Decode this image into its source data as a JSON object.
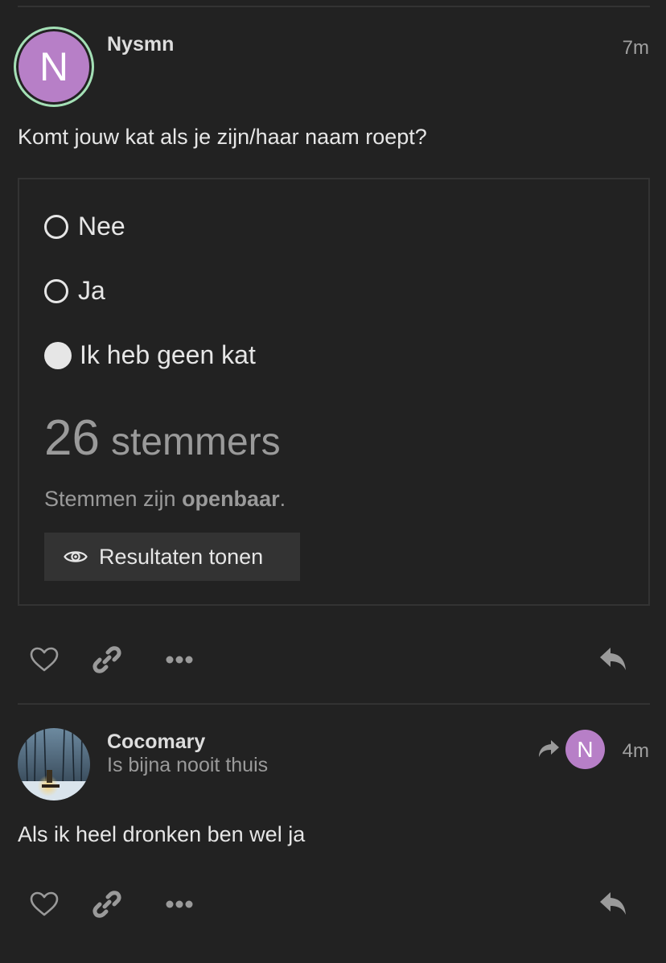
{
  "posts": [
    {
      "avatar_letter": "N",
      "username": "Nysmn",
      "time": "7m",
      "text": "Komt jouw kat als je zijn/haar naam roept?",
      "poll": {
        "options": [
          {
            "label": "Nee",
            "selected": false
          },
          {
            "label": "Ja",
            "selected": false
          },
          {
            "label": "Ik heb geen kat",
            "selected": true
          }
        ],
        "voter_count": "26",
        "voter_label": "stemmers",
        "public_prefix": "Stemmen zijn ",
        "public_word": "openbaar",
        "public_suffix": ".",
        "results_button": "Resultaten tonen"
      }
    },
    {
      "username": "Cocomary",
      "subtitle": "Is bijna nooit thuis",
      "reply_to_avatar_letter": "N",
      "time": "4m",
      "text": "Als ik heel dronken ben wel ja"
    }
  ],
  "icons": {
    "like": "heart-icon",
    "link": "link-icon",
    "more": "more-dots-icon",
    "reply": "reply-icon",
    "reply_to": "reply-arrow-icon",
    "results": "eye-icon"
  },
  "colors": {
    "background": "#222222",
    "avatar": "#b77fc7",
    "online_ring": "#a3e0b5"
  }
}
